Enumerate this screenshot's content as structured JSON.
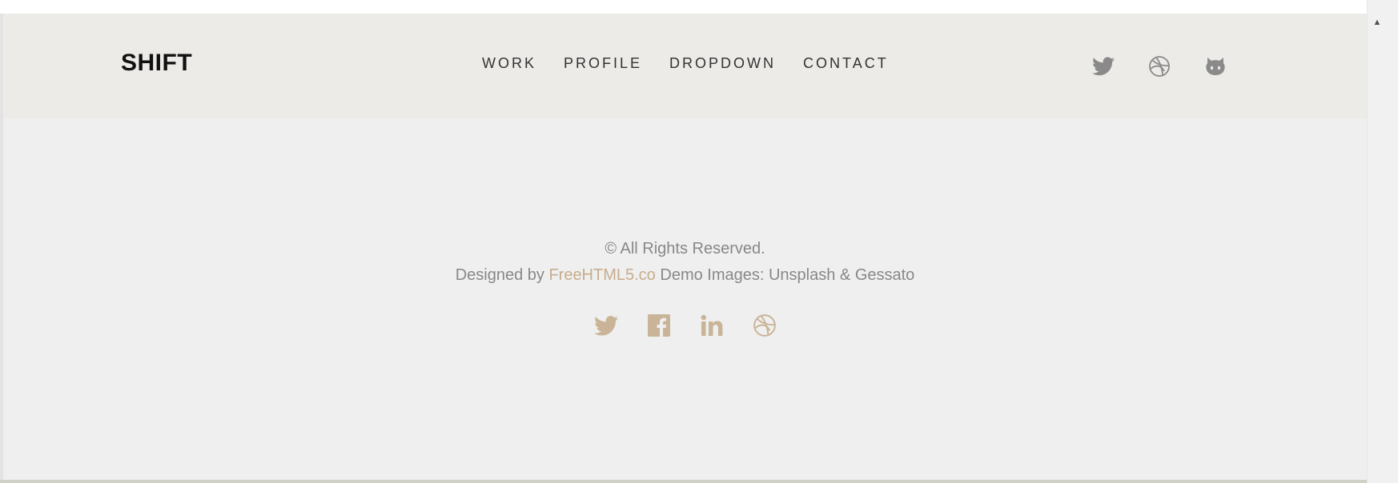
{
  "colors": {
    "navbar_bg": "#ecebe8",
    "page_bg": "#efefef",
    "accent": "#c7ad8c",
    "nav_icon": "#888888"
  },
  "navbar": {
    "brand": "SHIFT",
    "menu": [
      {
        "label": "WORK"
      },
      {
        "label": "PROFILE"
      },
      {
        "label": "DROPDOWN"
      },
      {
        "label": "CONTACT"
      }
    ],
    "social": [
      "twitter-icon",
      "dribbble-icon",
      "github-icon"
    ]
  },
  "footer": {
    "copyright": "© All Rights Reserved.",
    "designed_by_prefix": "Designed by",
    "credit_link": "FreeHTML5.co",
    "demo_images": "Demo Images: Unsplash & Gessato",
    "social": [
      "twitter-icon",
      "facebook-icon",
      "linkedin-icon",
      "dribbble-icon"
    ]
  },
  "scrollbar": {
    "up_arrow": "▲"
  }
}
